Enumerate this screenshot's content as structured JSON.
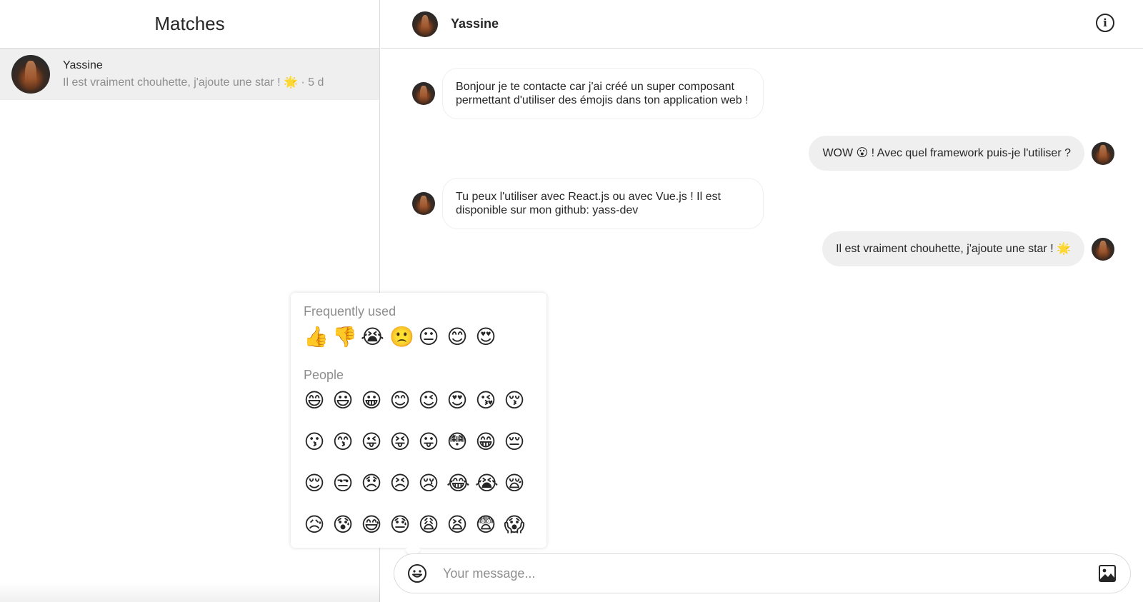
{
  "sidebar": {
    "title": "Matches",
    "matches": [
      {
        "name": "Yassine",
        "preview": "Il est vraiment chouhette, j'ajoute une star ! 🌟 · 5 d"
      }
    ]
  },
  "chat": {
    "header": {
      "name": "Yassine",
      "info_icon": "info-icon"
    },
    "messages": [
      {
        "direction": "incoming",
        "text": "Bonjour je te contacte car j'ai créé un super composant permettant d'utiliser des émojis dans ton application web !"
      },
      {
        "direction": "outgoing",
        "text": "WOW 😮 ! Avec quel framework puis-je l'utiliser ?"
      },
      {
        "direction": "incoming",
        "text": "Tu peux l'utiliser avec React.js ou avec Vue.js ! Il est disponible sur mon github: yass-dev"
      },
      {
        "direction": "outgoing",
        "text": "Il est vraiment chouhette, j'ajoute une star ! 🌟"
      }
    ],
    "composer": {
      "placeholder": "Your message...",
      "emoji_icon": "smiley-icon",
      "image_icon": "image-icon"
    }
  },
  "emoji_picker": {
    "categories": [
      {
        "label": "Frequently used",
        "rows": [
          [
            "👍",
            "👎",
            "😭",
            "🙁",
            "😐",
            "😊",
            "😍"
          ]
        ]
      },
      {
        "label": "People",
        "rows": [
          [
            "😄",
            "😃",
            "😀",
            "😊",
            "😉",
            "😍",
            "😘",
            "😚"
          ],
          [
            "😗",
            "😙",
            "😜",
            "😝",
            "😛",
            "😳",
            "😁",
            "😔"
          ],
          [
            "😌",
            "😒",
            "😞",
            "😣",
            "😢",
            "😂",
            "😭",
            "😪"
          ],
          [
            "😥",
            "😰",
            "😅",
            "😓",
            "😩",
            "😫",
            "😨",
            "😱"
          ]
        ]
      }
    ]
  }
}
